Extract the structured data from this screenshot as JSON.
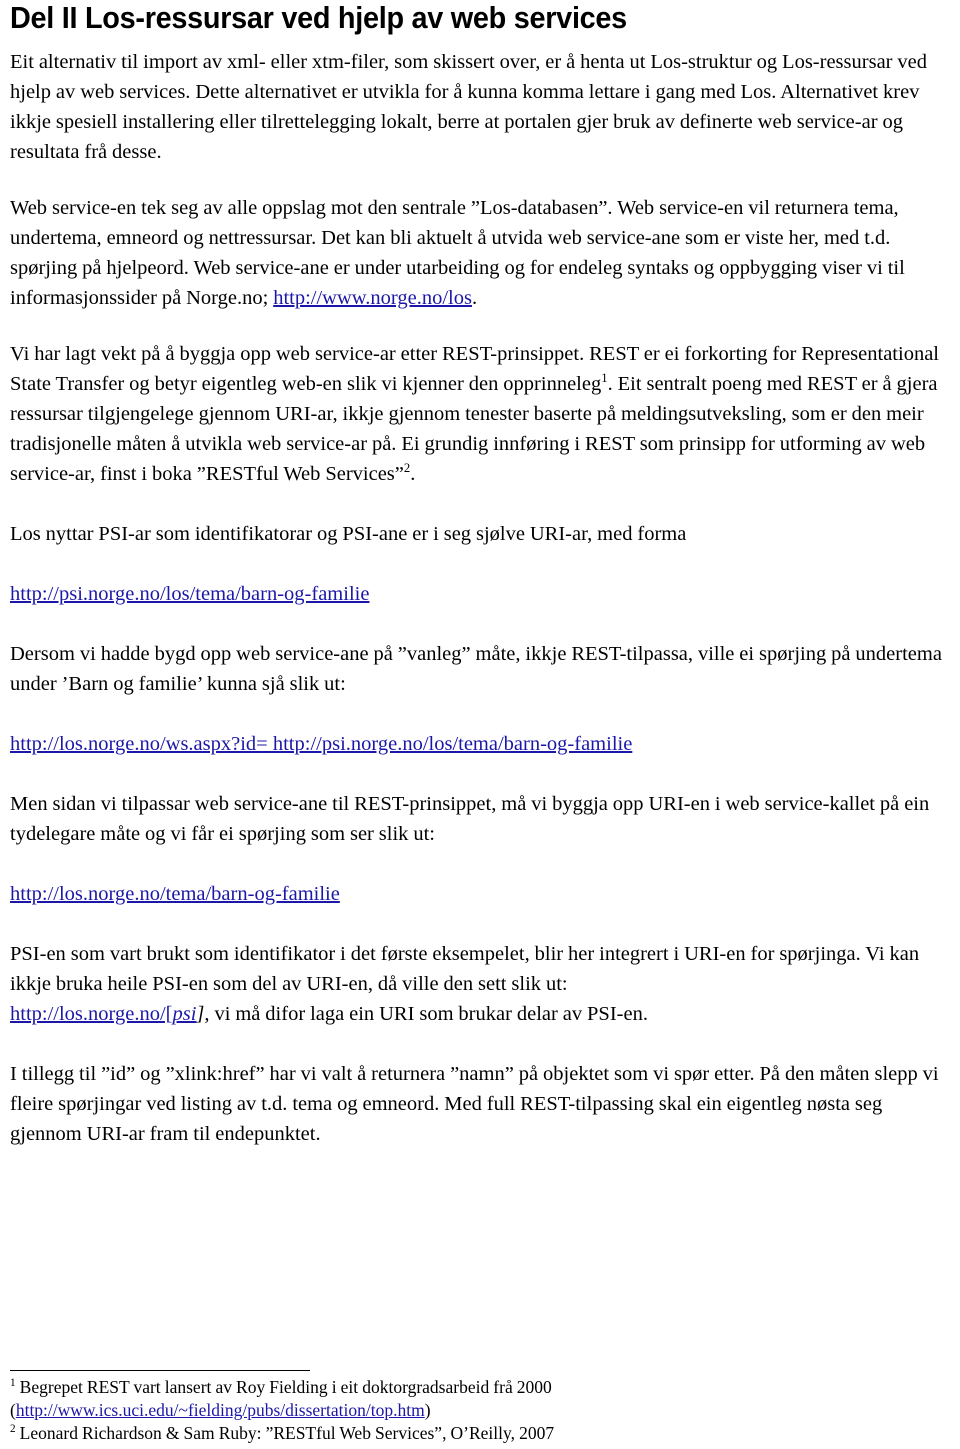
{
  "document": {
    "heading": "Del II Los-ressursar ved hjelp av web services",
    "link_color": "#1b17a8",
    "text_color": "#000000",
    "background_color": "#ffffff"
  },
  "paragraphs": {
    "p1": "Eit alternativ til import av xml- eller xtm-filer, som skissert over, er å henta ut Los-struktur og Los-ressursar ved hjelp av web services. Dette alternativet er utvikla for å kunna komma lettare i gang med Los. Alternativet krev ikkje spesiell installering eller tilrettelegging lokalt, berre at portalen gjer bruk av definerte web service-ar og resultata frå desse.",
    "p2_before_link": "Web service-en tek seg av alle oppslag mot den sentrale ”Los-databasen”. Web service-en vil returnera tema, undertema, emneord og nettressursar. Det kan bli aktuelt å utvida web service-ane som er viste her, med t.d. spørjing på hjelpeord. Web service-ane er under utarbeiding og for endeleg syntaks og oppbygging viser vi til informasjonssider på Norge.no; ",
    "p2_link": "http://www.norge.no/los",
    "p2_after_link": ".",
    "p3_part1": "Vi har lagt vekt på å byggja opp web service-ar etter REST-prinsippet. REST er ei forkorting for Representational State Transfer og betyr eigentleg web-en slik vi kjenner den opprinneleg",
    "p3_sup1": "1",
    "p3_part2": ". Eit sentralt poeng med REST er å gjera ressursar tilgjengelege gjennom URI-ar, ikkje gjennom tenester baserte på meldingsutveksling, som er den meir tradisjonelle måten å utvikla web service-ar på. Ei grundig innføring i REST som prinsipp for utforming av web service-ar, finst i boka ”RESTful Web Services”",
    "p3_sup2": "2",
    "p3_part3": ".",
    "p4": "Los nyttar PSI-ar som identifikatorar og PSI-ane er i seg sjølve URI-ar, med forma",
    "url1": "http://psi.norge.no/los/tema/barn-og-familie",
    "p5": "Dersom vi hadde bygd opp web service-ane på ”vanleg” måte, ikkje REST-tilpassa, ville ei spørjing på undertema under ’Barn og familie’ kunna sjå slik ut:",
    "url2": "http://los.norge.no/ws.aspx?id= http://psi.norge.no/los/tema/barn-og-familie",
    "p6": "Men sidan vi tilpassar web service-ane til REST-prinsippet, må vi byggja opp URI-en i web service-kallet på ein tydelegare måte og vi får ei spørjing som ser slik ut:",
    "url3": "http://los.norge.no/tema/barn-og-familie",
    "p7_line1": "PSI-en som vart brukt som identifikator i det første eksempelet, blir her integrert i URI-en for spørjinga. Vi kan ikkje bruka heile PSI-en som del av URI-en, då ville den sett slik ut:",
    "p7_link_prefix": "http://los.norge.no/[",
    "p7_link_italic": "psi",
    "p7_link_suffix": "]",
    "p7_after_link": ", vi må difor laga ein URI som brukar delar av PSI-en.",
    "p8": "I tillegg  til ”id” og ”xlink:href” har vi valt å returnera ”namn” på objektet som vi spør etter. På den måten slepp vi fleire spørjingar ved listing av t.d. tema og emneord. Med full REST-tilpassing skal ein eigentleg nøsta seg gjennom URI-ar fram til endepunktet."
  },
  "footnotes": {
    "fn1_marker": "1",
    "fn1_text": "Begrepet REST vart lansert av Roy Fielding i eit doktorgradsarbeid frå 2000",
    "fn1_paren_open": "(",
    "fn1_link": "http://www.ics.uci.edu/~fielding/pubs/dissertation/top.htm",
    "fn1_paren_close": ")",
    "fn2_marker": "2",
    "fn2_text": "Leonard Richardson & Sam Ruby: ”RESTful Web Services”, O’Reilly, 2007"
  }
}
